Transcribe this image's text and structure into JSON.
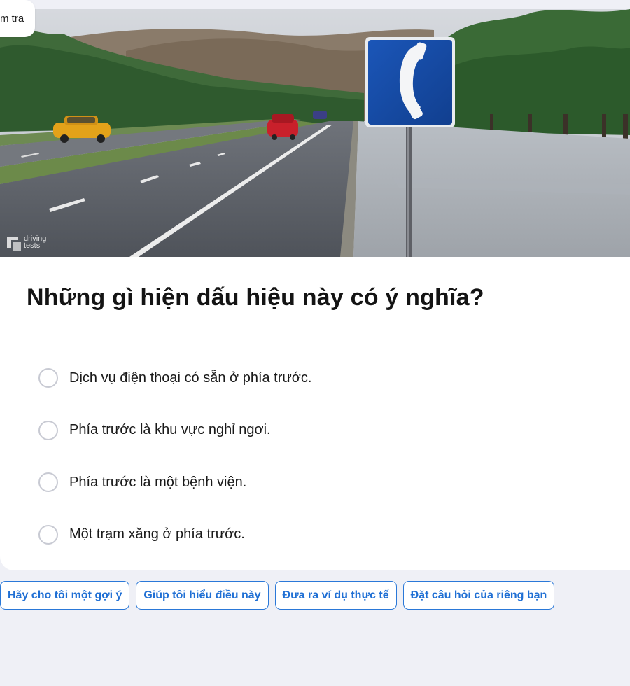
{
  "header": {
    "tab_label": "m tra"
  },
  "image": {
    "watermark_line1": "driving",
    "watermark_line2": "tests",
    "sign_icon": "telephone-icon"
  },
  "question": "Những gì hiện dấu hiệu này có ý nghĩa?",
  "options": [
    {
      "label": "Dịch vụ điện thoại có sẵn ở phía trước."
    },
    {
      "label": "Phía trước là khu vực nghỉ ngơi."
    },
    {
      "label": "Phía trước là một bệnh viện."
    },
    {
      "label": "Một trạm xăng ở phía trước."
    }
  ],
  "actions": [
    {
      "label": "Hãy cho tôi một gợi ý"
    },
    {
      "label": "Giúp tôi hiểu điều này"
    },
    {
      "label": "Đưa ra ví dụ thực tế"
    },
    {
      "label": "Đặt câu hỏi của riêng bạn"
    }
  ],
  "colors": {
    "page_bg": "#eff0f6",
    "accent": "#1f6fd4",
    "sign_blue": "#1449a3"
  }
}
